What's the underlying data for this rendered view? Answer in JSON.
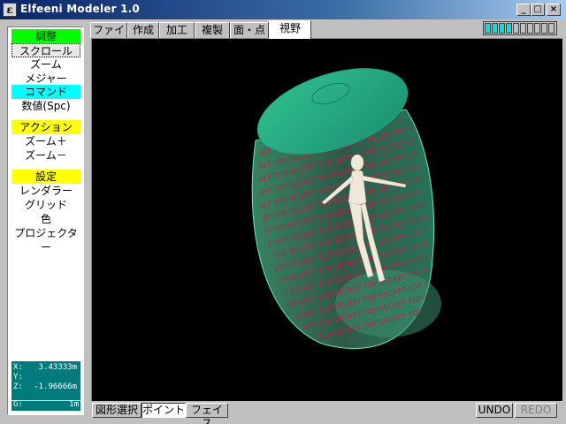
{
  "window": {
    "title": "Elfeeni Modeler 1.0",
    "icon_glyph": "ε",
    "min": "_",
    "max": "□",
    "close": "×"
  },
  "menu": {
    "adjust_header": "調整",
    "scroll": "スクロール",
    "zoom": "ズーム",
    "measure": "メジャー",
    "command_header": "コマンド",
    "numeric": "数値(Spc)",
    "action_header": "アクション",
    "zoom_in": "ズーム＋",
    "zoom_out": "ズーム－",
    "settings_header": "設定",
    "renderer": "レンダラー",
    "grid": "グリッド",
    "color": "色",
    "projector": "プロジェクター"
  },
  "coords": {
    "x_label": "X:",
    "x_value": "3.43333m",
    "y_label": "Y:",
    "y_value": "",
    "z_label": "Z:",
    "z_value": "-1.96666m",
    "g_label": "G:",
    "g_value": "1m"
  },
  "tabs": [
    "ファイル",
    "作成",
    "加工",
    "複製",
    "面・点",
    "視野"
  ],
  "active_tab": "視野",
  "indicator": {
    "filled": 4,
    "total": 10,
    "fill_color": "#00e0e0"
  },
  "viewport": {
    "label_text": [
      "SECRET",
      "TOP"
    ],
    "text_color": "#c02040",
    "mesh_color": "#40e0a0"
  },
  "bottom": {
    "select_shape": "図形選択",
    "point": "ポイント",
    "face": "フェイス",
    "undo": "UNDO",
    "redo": "REDO"
  }
}
